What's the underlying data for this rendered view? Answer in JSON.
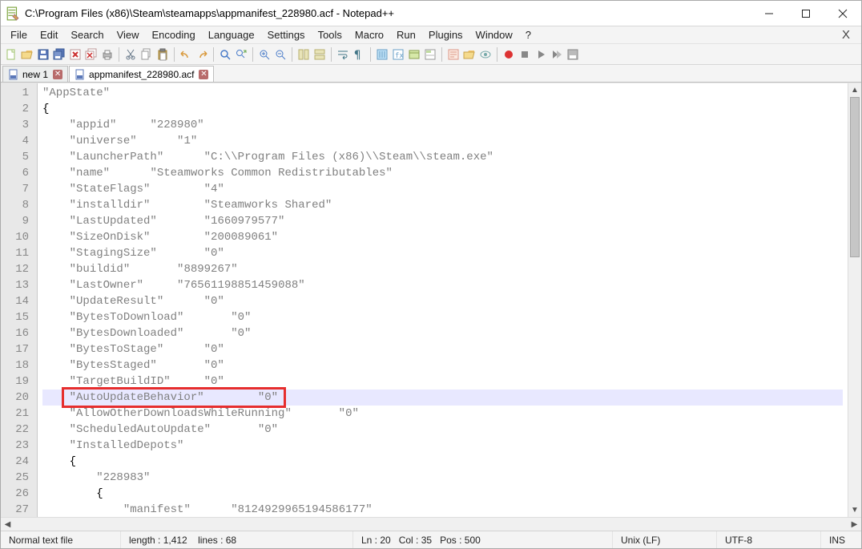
{
  "window": {
    "title": "C:\\Program Files (x86)\\Steam\\steamapps\\appmanifest_228980.acf - Notepad++"
  },
  "menu": {
    "items": [
      "File",
      "Edit",
      "Search",
      "View",
      "Encoding",
      "Language",
      "Settings",
      "Tools",
      "Macro",
      "Run",
      "Plugins",
      "Window",
      "?"
    ]
  },
  "toolbar_icons": [
    "new-file",
    "open-file",
    "save-file",
    "save-all",
    "close-file",
    "close-all",
    "print",
    "sep",
    "cut",
    "copy",
    "paste",
    "sep",
    "undo",
    "redo",
    "sep",
    "search",
    "replace",
    "sep",
    "zoom-in",
    "zoom-out",
    "sep",
    "sync-v",
    "sync-h",
    "sep",
    "word-wrap",
    "whitespace",
    "sep",
    "indent-guide",
    "lang",
    "folder",
    "doc-map",
    "sep",
    "func-list",
    "folder-open",
    "monitor",
    "sep",
    "record-macro",
    "stop-macro",
    "play-macro",
    "play-multi",
    "save-macro"
  ],
  "tabs": [
    {
      "label": "new 1",
      "active": false
    },
    {
      "label": "appmanifest_228980.acf",
      "active": true
    }
  ],
  "code": {
    "highlight_line": 20,
    "lines": [
      "\"AppState\"",
      "{",
      "    \"appid\"     \"228980\"",
      "    \"universe\"      \"1\"",
      "    \"LauncherPath\"      \"C:\\\\Program Files (x86)\\\\Steam\\\\steam.exe\"",
      "    \"name\"      \"Steamworks Common Redistributables\"",
      "    \"StateFlags\"        \"4\"",
      "    \"installdir\"        \"Steamworks Shared\"",
      "    \"LastUpdated\"       \"1660979577\"",
      "    \"SizeOnDisk\"        \"200089061\"",
      "    \"StagingSize\"       \"0\"",
      "    \"buildid\"       \"8899267\"",
      "    \"LastOwner\"     \"76561198851459088\"",
      "    \"UpdateResult\"      \"0\"",
      "    \"BytesToDownload\"       \"0\"",
      "    \"BytesDownloaded\"       \"0\"",
      "    \"BytesToStage\"      \"0\"",
      "    \"BytesStaged\"       \"0\"",
      "    \"TargetBuildID\"     \"0\"",
      "    \"AutoUpdateBehavior\"        \"0\"",
      "    \"AllowOtherDownloadsWhileRunning\"       \"0\"",
      "    \"ScheduledAutoUpdate\"       \"0\"",
      "    \"InstalledDepots\"",
      "    {",
      "        \"228983\"",
      "        {",
      "            \"manifest\"      \"8124929965194586177\""
    ]
  },
  "status": {
    "filetype": "Normal text file",
    "length_label": "length : 1,412",
    "lines_label": "lines : 68",
    "ln_label": "Ln : 20",
    "col_label": "Col : 35",
    "pos_label": "Pos : 500",
    "eol": "Unix (LF)",
    "encoding": "UTF-8",
    "ins": "INS"
  }
}
